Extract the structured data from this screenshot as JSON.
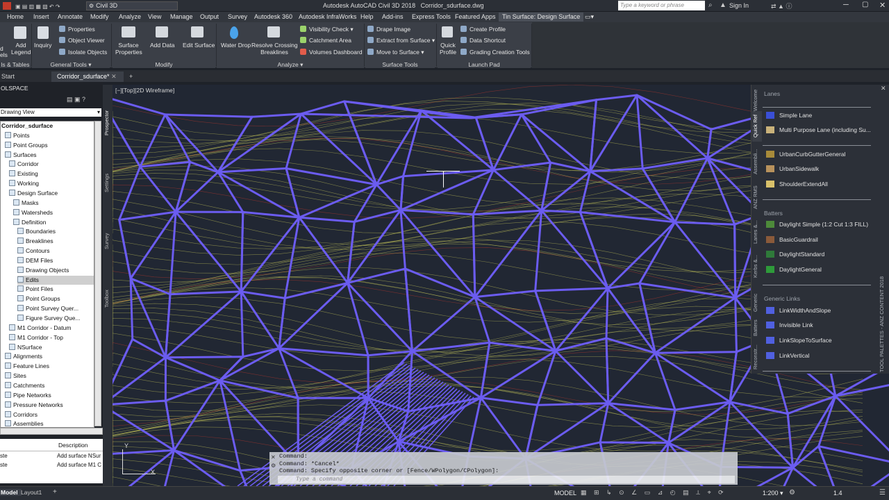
{
  "titlebar": {
    "workspace": "Civil 3D",
    "title": "Autodesk AutoCAD Civil 3D 2018",
    "filename": "Corridor_sdurface.dwg",
    "search_placeholder": "Type a keyword or phrase",
    "sign_in": "Sign In"
  },
  "menus": [
    "Home",
    "Insert",
    "Annotate",
    "Modify",
    "Analyze",
    "View",
    "Manage",
    "Output",
    "Survey",
    "Autodesk 360",
    "Autodesk InfraWorks",
    "Help",
    "Add-ins",
    "Express Tools",
    "Featured Apps",
    "Tin Surface: Design Surface"
  ],
  "ribbon": {
    "partial_left_1": "d",
    "partial_left_2": "els",
    "add_legend": [
      "Add",
      "Legend"
    ],
    "inquiry": "Inquiry",
    "properties": "Properties",
    "object_viewer": "Object Viewer",
    "isolate_objects": "Isolate Objects",
    "surface_properties": [
      "Surface",
      "Properties"
    ],
    "add_data": "Add Data",
    "edit_surface": "Edit Surface",
    "water_drop": "Water Drop",
    "resolve_crossing": [
      "Resolve Crossing",
      "Breaklines"
    ],
    "visibility_check": "Visibility Check",
    "catchment_area": "Catchment Area",
    "volumes_dashboard": "Volumes Dashboard",
    "drape_image": "Drape Image",
    "extract_from_surface": "Extract from Surface",
    "move_to_surface": "Move to Surface",
    "quick_profile": [
      "Quick",
      "Profile"
    ],
    "create_profile": "Create Profile",
    "data_shortcut": "Data Shortcut",
    "grading_creation_tools": "Grading Creation Tools",
    "panels": [
      "ls & Tables",
      "General Tools",
      "Modify",
      "Analyze",
      "Surface Tools",
      "Launch Pad"
    ]
  },
  "doctabs": {
    "start": "Start",
    "active": "Corridor_sdurface*"
  },
  "toolspace": {
    "header": "OLSPACE",
    "view": "Drawing View",
    "tree": [
      {
        "label": "Corridor_sdurface",
        "level": 0,
        "bold": true
      },
      {
        "label": "Points",
        "level": 1
      },
      {
        "label": "Point Groups",
        "level": 1
      },
      {
        "label": "Surfaces",
        "level": 1
      },
      {
        "label": "Corridor",
        "level": 2
      },
      {
        "label": "Existing",
        "level": 2
      },
      {
        "label": "Working",
        "level": 2
      },
      {
        "label": "Design Surface",
        "level": 2
      },
      {
        "label": "Masks",
        "level": 3
      },
      {
        "label": "Watersheds",
        "level": 3
      },
      {
        "label": "Definition",
        "level": 3
      },
      {
        "label": "Boundaries",
        "level": 4
      },
      {
        "label": "Breaklines",
        "level": 4
      },
      {
        "label": "Contours",
        "level": 4
      },
      {
        "label": "DEM Files",
        "level": 4
      },
      {
        "label": "Drawing Objects",
        "level": 4
      },
      {
        "label": "Edits",
        "level": 4,
        "selected": true
      },
      {
        "label": "Point Files",
        "level": 4
      },
      {
        "label": "Point Groups",
        "level": 4
      },
      {
        "label": "Point Survey Quer...",
        "level": 4
      },
      {
        "label": "Figure Survey Que...",
        "level": 4
      },
      {
        "label": "M1 Corridor - Datum",
        "level": 2
      },
      {
        "label": "M1 Corridor - Top",
        "level": 2
      },
      {
        "label": "NSurface",
        "level": 2
      },
      {
        "label": "Alignments",
        "level": 1
      },
      {
        "label": "Feature Lines",
        "level": 1
      },
      {
        "label": "Sites",
        "level": 1
      },
      {
        "label": "Catchments",
        "level": 1
      },
      {
        "label": "Pipe Networks",
        "level": 1
      },
      {
        "label": "Pressure Networks",
        "level": 1
      },
      {
        "label": "Corridors",
        "level": 1
      },
      {
        "label": "Assemblies",
        "level": 1
      }
    ],
    "list_header": "Description",
    "list_rows": [
      {
        "col1": "ste",
        "col2": "Add surface NSur"
      },
      {
        "col1": "ste",
        "col2": "Add surface M1 C"
      }
    ],
    "side_tabs": [
      "Prospector",
      "Settings",
      "Survey",
      "Toolbox"
    ]
  },
  "viewport": {
    "label": "[−][Top][2D Wireframe]"
  },
  "palette": {
    "sections": [
      {
        "title": "Lanes",
        "items": [
          "Simple Lane",
          "Multi Purpose Lane (including Su..."
        ]
      },
      {
        "title": "",
        "items": [
          "UrbanCurbGutterGeneral",
          "UrbanSidewalk",
          "ShoulderExtendAll"
        ]
      },
      {
        "title": "Batters",
        "items": [
          "Daylight Simple (1:2 Cut 1:3 FILL)",
          "BasicGuardrail",
          "DaylightStandard",
          "DaylightGeneral"
        ]
      },
      {
        "title": "Generic Links",
        "items": [
          "LinkWidthAndSlope",
          "Invisible Link",
          "LinkSlopeToSurface",
          "LinkVertical"
        ]
      }
    ],
    "tabs": [
      "Welcome",
      "Quick Ref",
      "Assembli...",
      "ANZ RMS",
      "Lanes &...",
      "Kerbs &...",
      "Generic",
      "Batters",
      "Reconstr..."
    ],
    "side_title": "TOOL PALETTES - ANZ CONTENT 2018"
  },
  "command": {
    "lines": [
      "Command:",
      "Command: *Cancel*",
      "Command: Specify opposite corner or [Fence/WPolygon/CPolygon]:"
    ],
    "placeholder": "Type a command"
  },
  "status": {
    "model_tab": "Model",
    "layout_tab": "Layout1",
    "model": "MODEL",
    "scale": "1:200",
    "annot": "1.4"
  },
  "colors": {
    "mesh": "#6b5cf0",
    "canvas": "#212733",
    "ribbon": "#3b3f47",
    "contour": "#c8c85a",
    "red": "#c0392b"
  }
}
